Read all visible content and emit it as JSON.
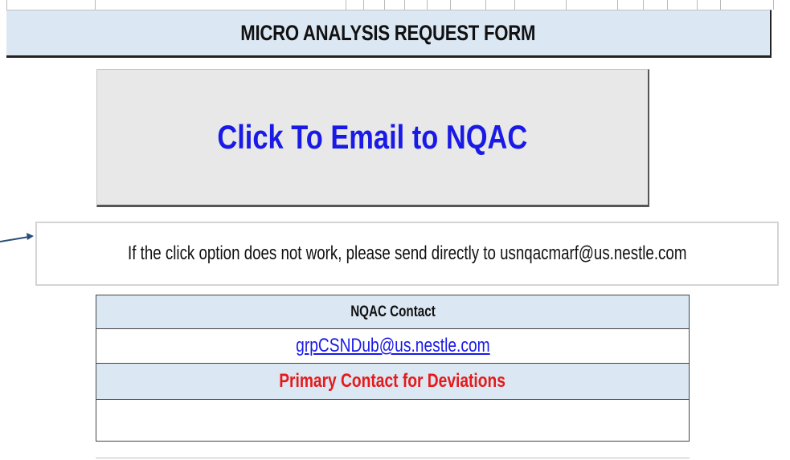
{
  "form": {
    "title": "MICRO ANALYSIS REQUEST FORM",
    "email_button_label": "Click To Email to NQAC",
    "fallback_note": "If the click option does not work, please send directly to  usnqacmarf@us.nestle.com"
  },
  "contact_table": {
    "header": "NQAC Contact",
    "contact_email": "grpCSNDub@us.nestle.com",
    "primary_label": "Primary Contact for Deviations",
    "primary_value": ""
  },
  "colors": {
    "header_fill": "#dbe7f3",
    "button_text": "#1a1ae6",
    "primary_text": "#e61a1a",
    "arrow": "#2a4e7a"
  },
  "icons": {
    "pointer_arrow": "arrow-right-icon"
  }
}
